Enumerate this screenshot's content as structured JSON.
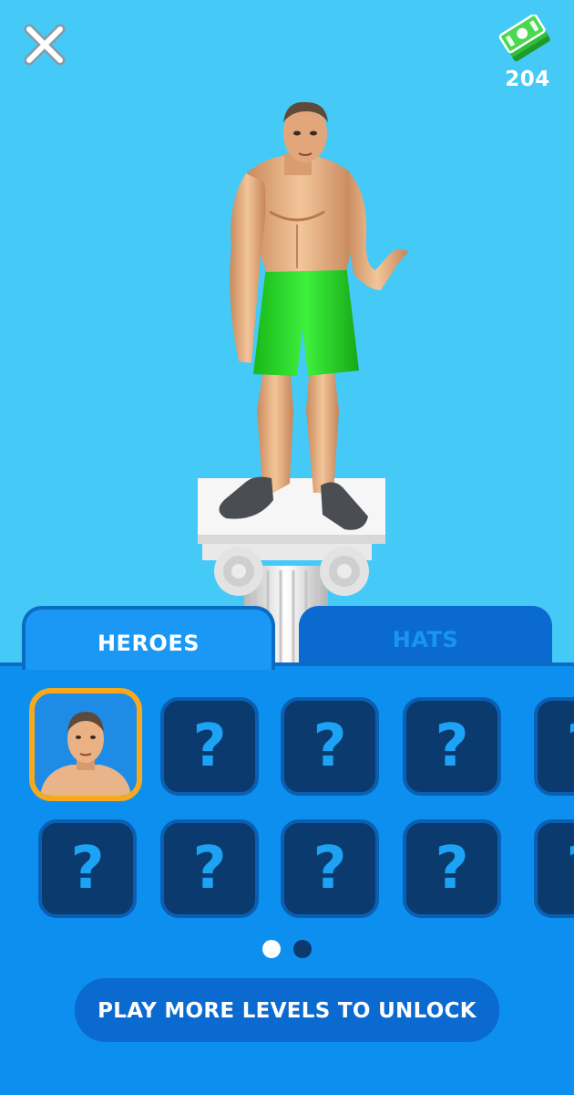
{
  "header": {
    "close_icon": "close-x-icon",
    "currency_icon": "cash-stack-icon",
    "currency_amount": "204"
  },
  "stage": {
    "character": "muscular-hero-green-shorts",
    "pedestal": "ionic-column-pedestal"
  },
  "tabs": [
    {
      "label": "HEROES",
      "selected": true
    },
    {
      "label": "HATS",
      "selected": false
    }
  ],
  "grid": {
    "rows": [
      [
        {
          "type": "hero-portrait",
          "selected": true
        },
        {
          "type": "locked",
          "label": "?"
        },
        {
          "type": "locked",
          "label": "?"
        },
        {
          "type": "locked",
          "label": "?"
        },
        {
          "type": "locked",
          "label": "?"
        }
      ],
      [
        {
          "type": "locked",
          "label": "?"
        },
        {
          "type": "locked",
          "label": "?"
        },
        {
          "type": "locked",
          "label": "?"
        },
        {
          "type": "locked",
          "label": "?"
        },
        {
          "type": "locked",
          "label": "?"
        }
      ]
    ]
  },
  "pagination": {
    "current": 1,
    "total": 2
  },
  "unlock_button": {
    "label": "PLAY MORE LEVELS TO UNLOCK"
  },
  "colors": {
    "background": "#45c9f6",
    "panel": "#0d8ff0",
    "tab_active": "#1b98f5",
    "tab_inactive": "#0b6ad0",
    "slot_locked": "#0a3a6e",
    "selected_border": "#f6a91c",
    "shorts": "#22d622"
  }
}
